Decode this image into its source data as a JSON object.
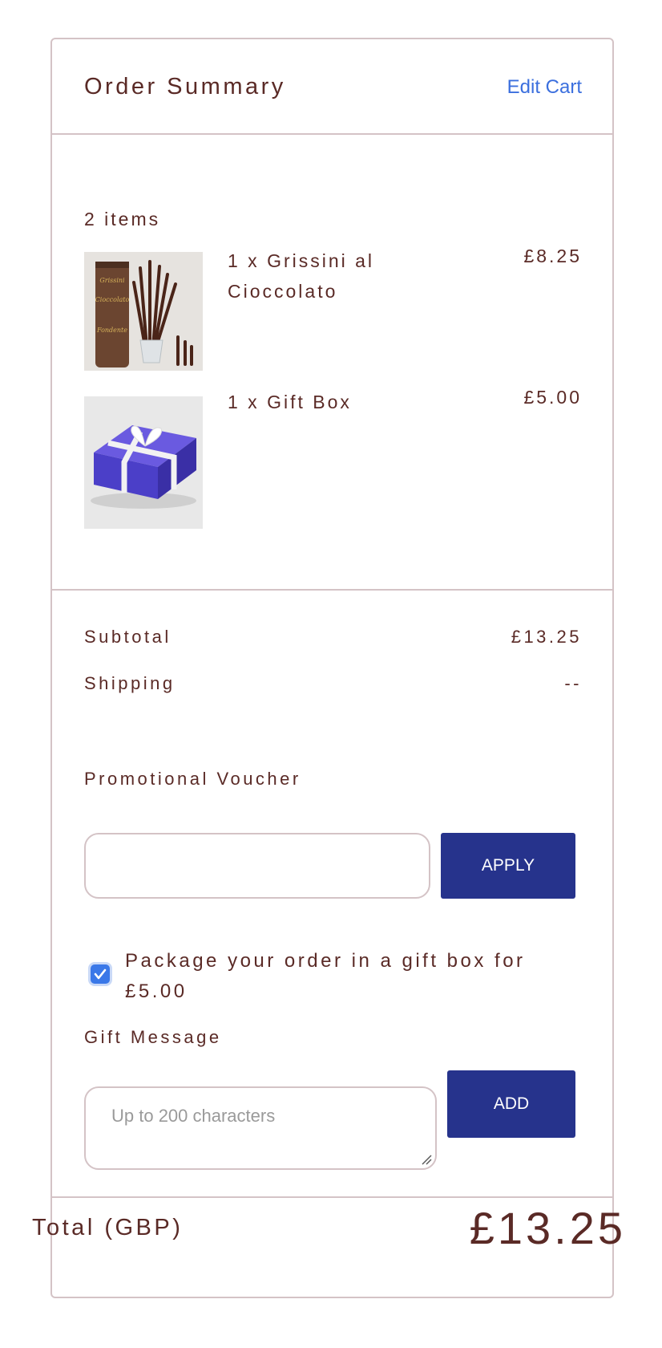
{
  "header": {
    "title": "Order Summary",
    "edit_cart": "Edit Cart"
  },
  "cart": {
    "count_label": "2 items",
    "items": [
      {
        "name": "1 x Grissini al Cioccolato",
        "price": "£8.25",
        "image": "grissini-product-photo"
      },
      {
        "name": "1 x Gift Box",
        "price": "£5.00",
        "image": "gift-box-product-photo"
      }
    ]
  },
  "summary": {
    "subtotal_label": "Subtotal",
    "subtotal_value": "£13.25",
    "shipping_label": "Shipping",
    "shipping_value": "--"
  },
  "voucher": {
    "label": "Promotional Voucher",
    "value": "",
    "apply_label": "APPLY"
  },
  "gift_box": {
    "checked": true,
    "label": "Package your order in a gift box for £5.00"
  },
  "gift_message": {
    "label": "Gift Message",
    "placeholder": "Up to 200 characters",
    "add_label": "ADD"
  },
  "total": {
    "label": "Total (GBP)",
    "value": "£13.25"
  },
  "colors": {
    "text": "#5a2a26",
    "accent": "#26338c",
    "link": "#3b6fde",
    "border": "#d4c3c6",
    "checkbox": "#3a78e8"
  }
}
